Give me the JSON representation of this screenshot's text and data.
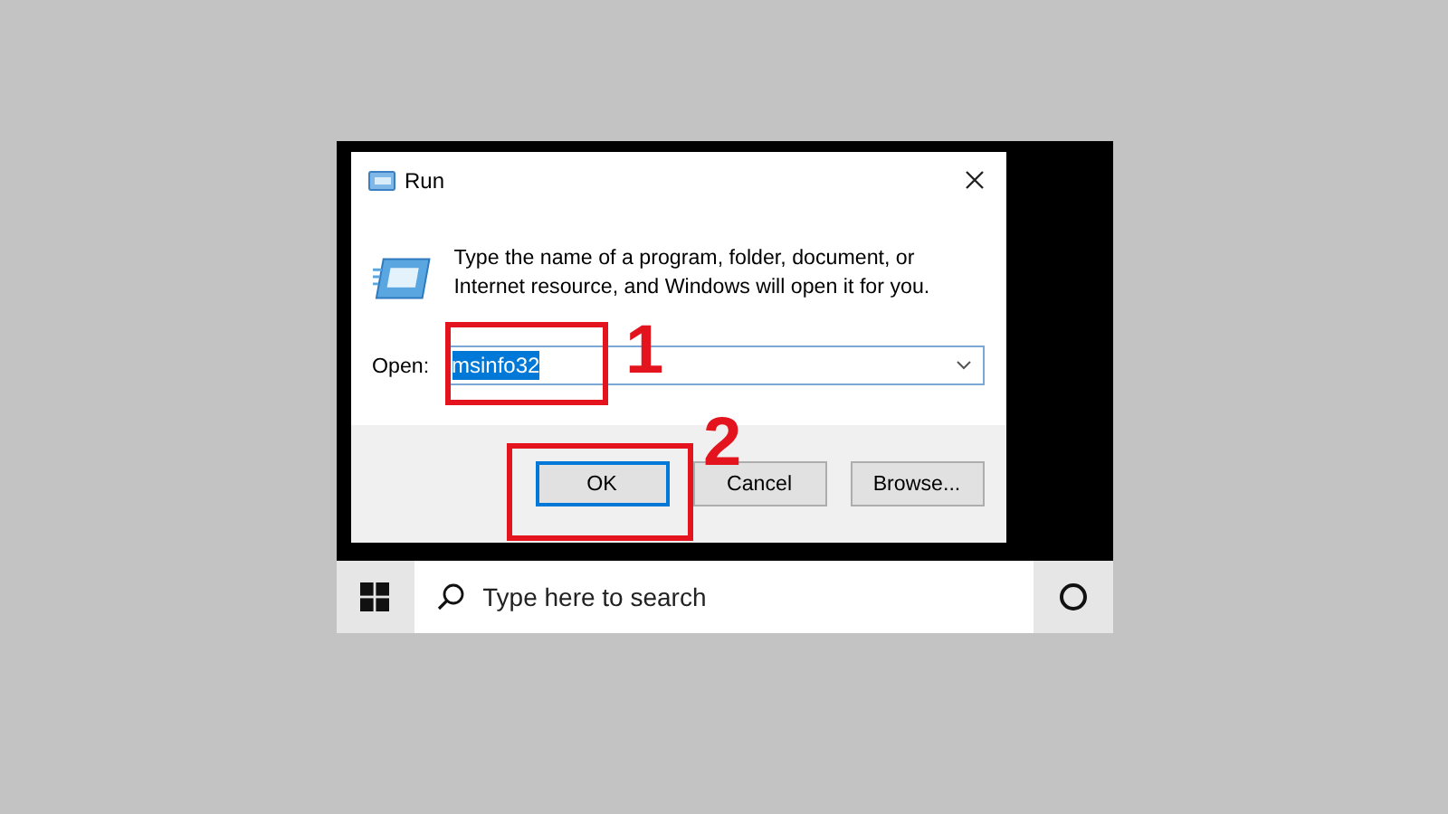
{
  "dialog": {
    "title": "Run",
    "description": "Type the name of a program, folder, document, or Internet resource, and Windows will open it for you.",
    "open_label": "Open:",
    "open_value": "msinfo32",
    "value_selected": true,
    "buttons": [
      {
        "label": "OK",
        "default": true
      },
      {
        "label": "Cancel",
        "default": false
      },
      {
        "label": "Browse...",
        "default": false
      }
    ]
  },
  "taskbar": {
    "search_placeholder": "Type here to search"
  },
  "annotations": [
    {
      "label": "1"
    },
    {
      "label": "2"
    }
  ]
}
